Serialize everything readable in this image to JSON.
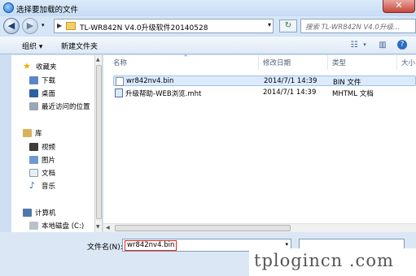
{
  "window": {
    "title": "选择要加载的文件",
    "close_label": "✕"
  },
  "nav": {
    "back": "◀",
    "forward": "▶",
    "address_path": "TL-WR842N V4.0升级软件20140528",
    "search_placeholder": "搜索 TL-WR842N V4.0升级..."
  },
  "toolbar": {
    "organize": "组织 ▾",
    "new_folder": "新建文件夹"
  },
  "sidebar": {
    "favorites": "收藏夹",
    "downloads": "下载",
    "desktop": "桌面",
    "recent": "最近访问的位置",
    "libraries": "库",
    "videos": "视频",
    "pictures": "图片",
    "documents": "文档",
    "music": "音乐",
    "computer": "计算机",
    "local_disk": "本地磁盘 (C:)"
  },
  "columns": {
    "name": "名称",
    "modified": "修改日期",
    "type": "类型",
    "size": "大小"
  },
  "files": [
    {
      "name": "wr842nv4.bin",
      "modified": "2014/7/1 14:39",
      "type": "BIN 文件"
    },
    {
      "name": "升级帮助-WEB浏览.mht",
      "modified": "2014/7/1 14:39",
      "type": "MHTML 文档"
    }
  ],
  "bottom": {
    "filename_label": "文件名(N):",
    "filename_value": "wr842nv4.bin"
  },
  "watermark": "tplogincn .com"
}
